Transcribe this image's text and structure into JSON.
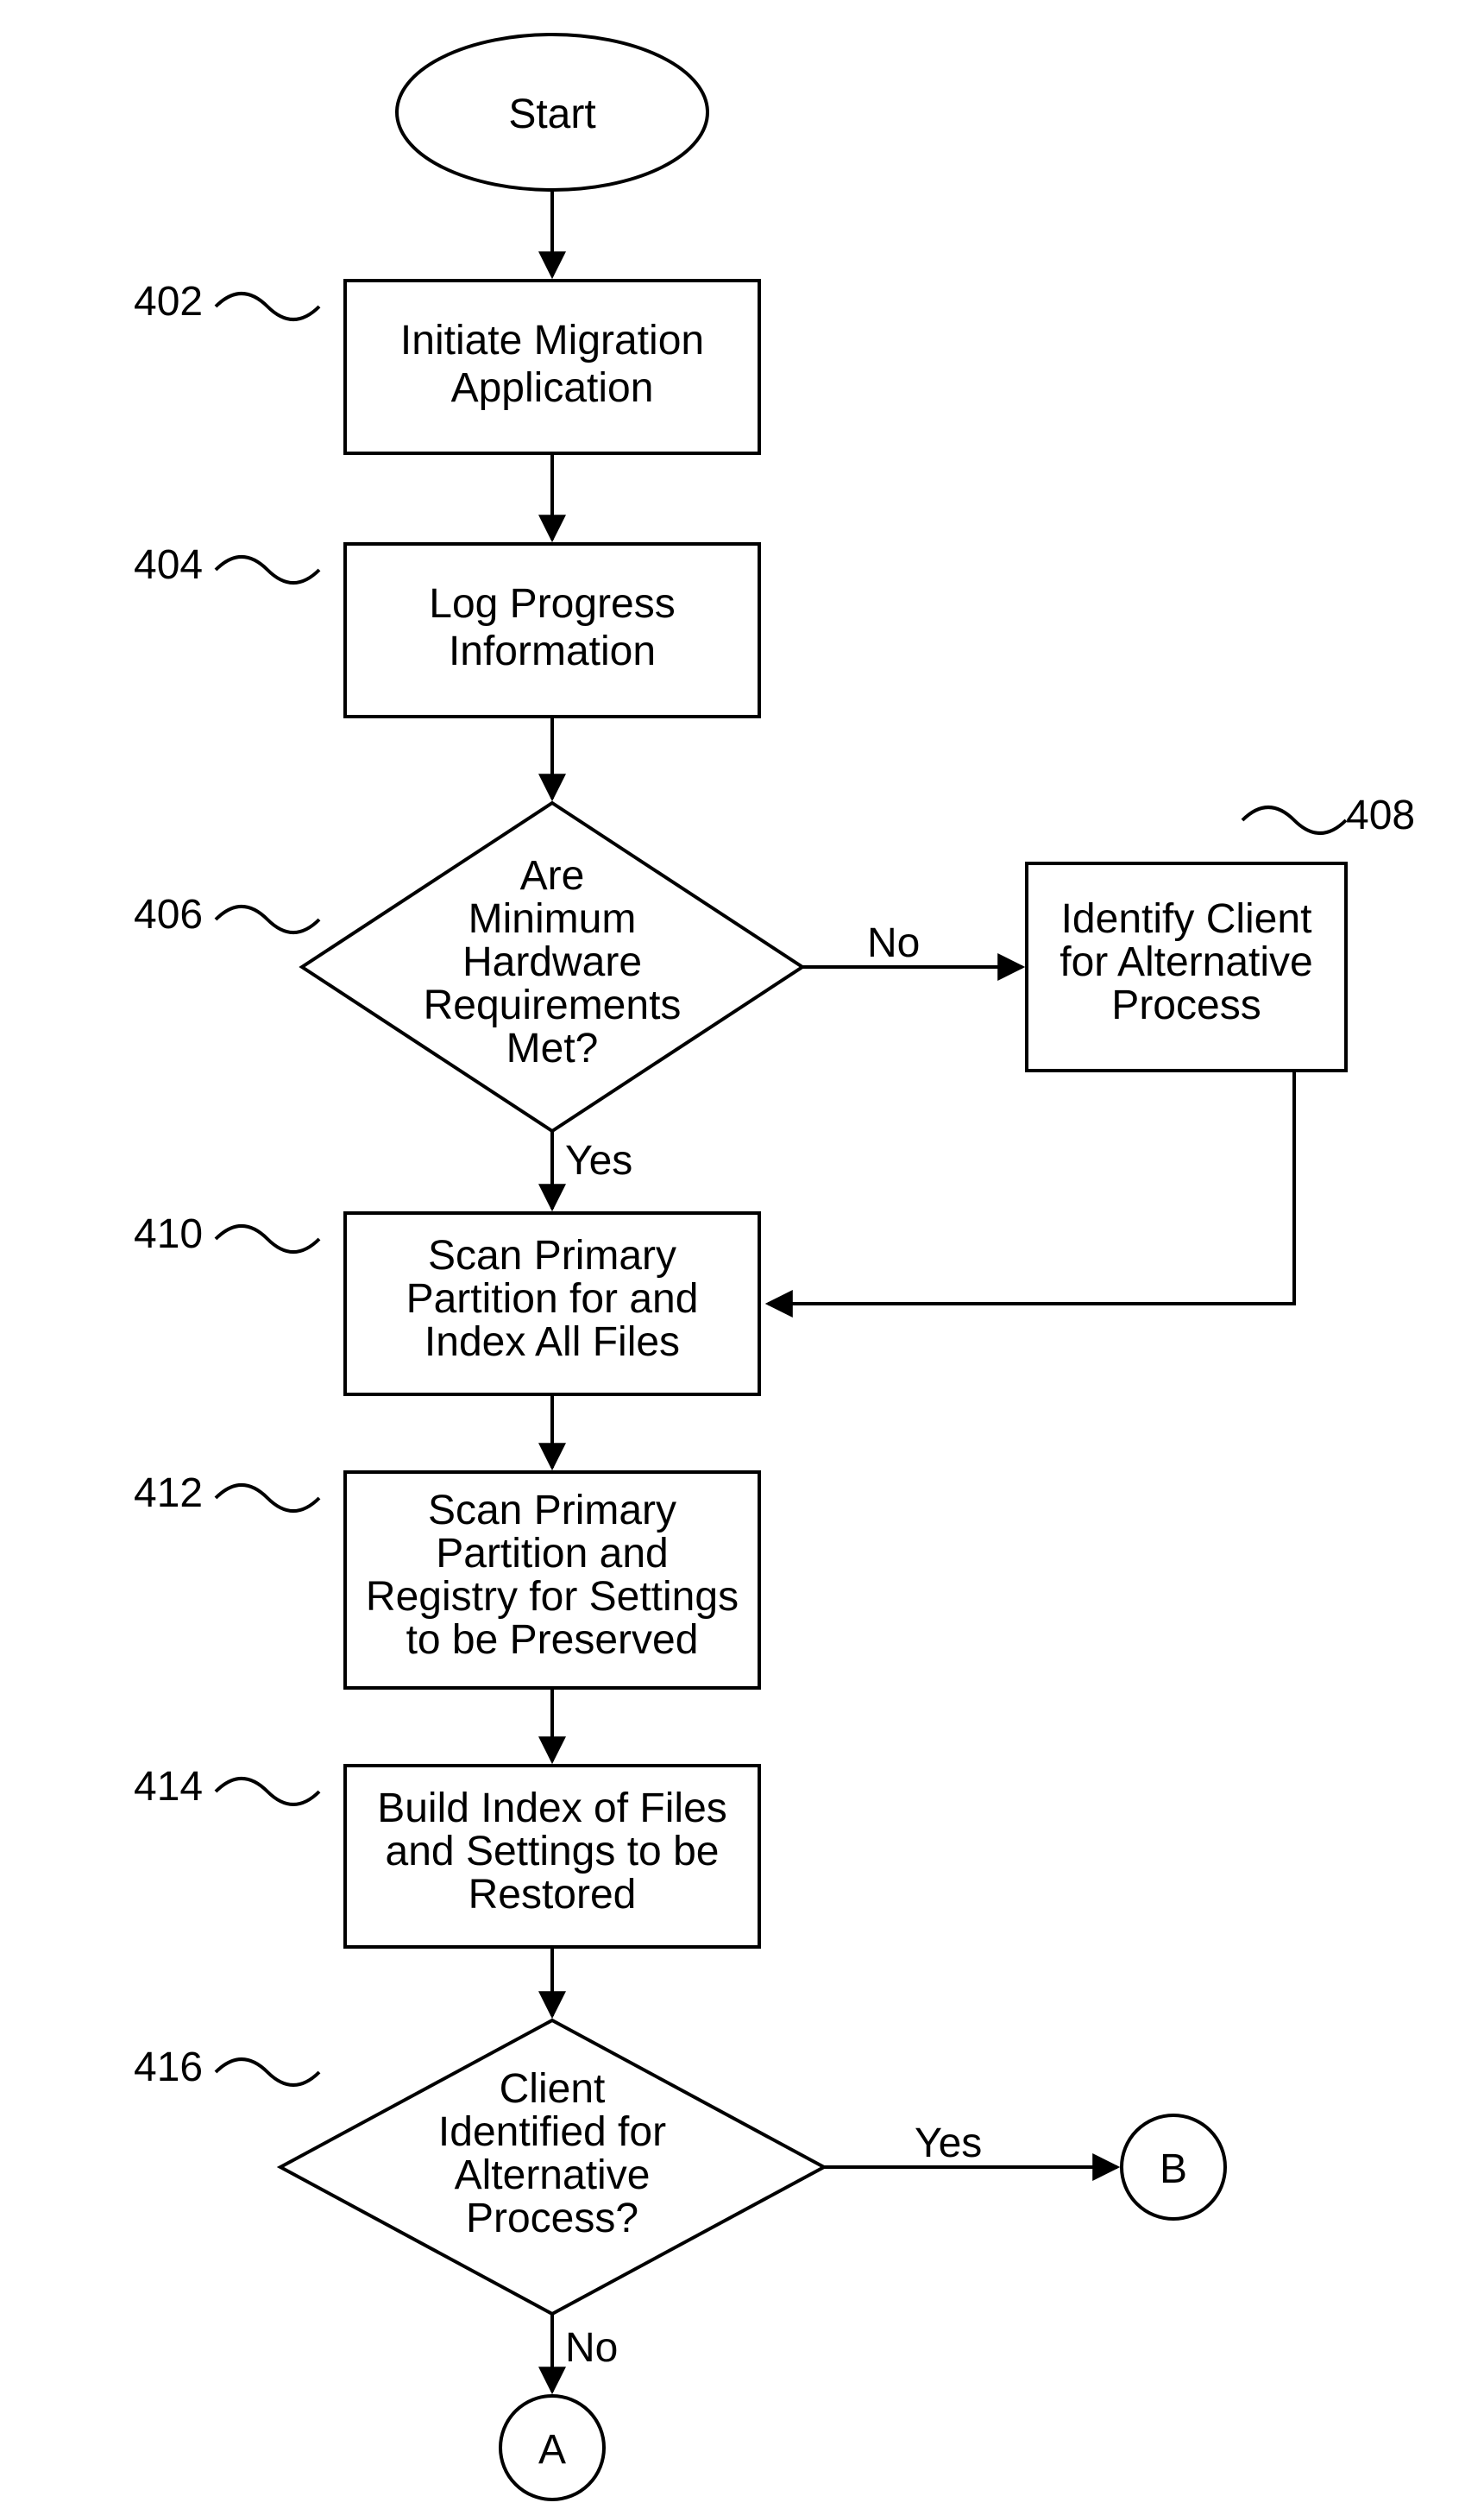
{
  "chart_data": {
    "type": "flowchart",
    "nodes": [
      {
        "id": "start",
        "kind": "terminator",
        "text": [
          "Start"
        ]
      },
      {
        "id": "n402",
        "kind": "process",
        "ref": "402",
        "text": [
          "Initiate Migration",
          "Application"
        ]
      },
      {
        "id": "n404",
        "kind": "process",
        "ref": "404",
        "text": [
          "Log Progress",
          "Information"
        ]
      },
      {
        "id": "n406",
        "kind": "decision",
        "ref": "406",
        "text": [
          "Are",
          "Minimum",
          "Hardware",
          "Requirements",
          "Met?"
        ]
      },
      {
        "id": "n408",
        "kind": "process",
        "ref": "408",
        "text": [
          "Identify Client",
          "for Alternative",
          "Process"
        ]
      },
      {
        "id": "n410",
        "kind": "process",
        "ref": "410",
        "text": [
          "Scan Primary",
          "Partition for and",
          "Index All Files"
        ]
      },
      {
        "id": "n412",
        "kind": "process",
        "ref": "412",
        "text": [
          "Scan Primary",
          "Partition and",
          "Registry for Settings",
          "to be Preserved"
        ]
      },
      {
        "id": "n414",
        "kind": "process",
        "ref": "414",
        "text": [
          "Build Index of Files",
          "and Settings to be",
          "Restored"
        ]
      },
      {
        "id": "n416",
        "kind": "decision",
        "ref": "416",
        "text": [
          "Client",
          "Identified for",
          "Alternative",
          "Process?"
        ]
      },
      {
        "id": "A",
        "kind": "connector",
        "text": [
          "A"
        ]
      },
      {
        "id": "B",
        "kind": "connector",
        "text": [
          "B"
        ]
      }
    ],
    "edges": [
      {
        "from": "start",
        "to": "n402"
      },
      {
        "from": "n402",
        "to": "n404"
      },
      {
        "from": "n404",
        "to": "n406"
      },
      {
        "from": "n406",
        "to": "n410",
        "label": "Yes"
      },
      {
        "from": "n406",
        "to": "n408",
        "label": "No"
      },
      {
        "from": "n408",
        "to": "n410"
      },
      {
        "from": "n410",
        "to": "n412"
      },
      {
        "from": "n412",
        "to": "n414"
      },
      {
        "from": "n414",
        "to": "n416"
      },
      {
        "from": "n416",
        "to": "A",
        "label": "No"
      },
      {
        "from": "n416",
        "to": "B",
        "label": "Yes"
      }
    ]
  },
  "refs": {
    "r402": "402",
    "r404": "404",
    "r406": "406",
    "r408": "408",
    "r410": "410",
    "r412": "412",
    "r414": "414",
    "r416": "416"
  },
  "labels": {
    "start": "Start",
    "yes": "Yes",
    "no": "No",
    "A": "A",
    "B": "B"
  },
  "steps": {
    "s402a": "Initiate Migration",
    "s402b": "Application",
    "s404a": "Log Progress",
    "s404b": "Information",
    "s406a": "Are",
    "s406b": "Minimum",
    "s406c": "Hardware",
    "s406d": "Requirements",
    "s406e": "Met?",
    "s408a": "Identify Client",
    "s408b": "for Alternative",
    "s408c": "Process",
    "s410a": "Scan Primary",
    "s410b": "Partition for and",
    "s410c": "Index All Files",
    "s412a": "Scan Primary",
    "s412b": "Partition and",
    "s412c": "Registry for Settings",
    "s412d": "to be Preserved",
    "s414a": "Build Index of Files",
    "s414b": "and Settings to be",
    "s414c": "Restored",
    "s416a": "Client",
    "s416b": "Identified for",
    "s416c": "Alternative",
    "s416d": "Process?"
  }
}
